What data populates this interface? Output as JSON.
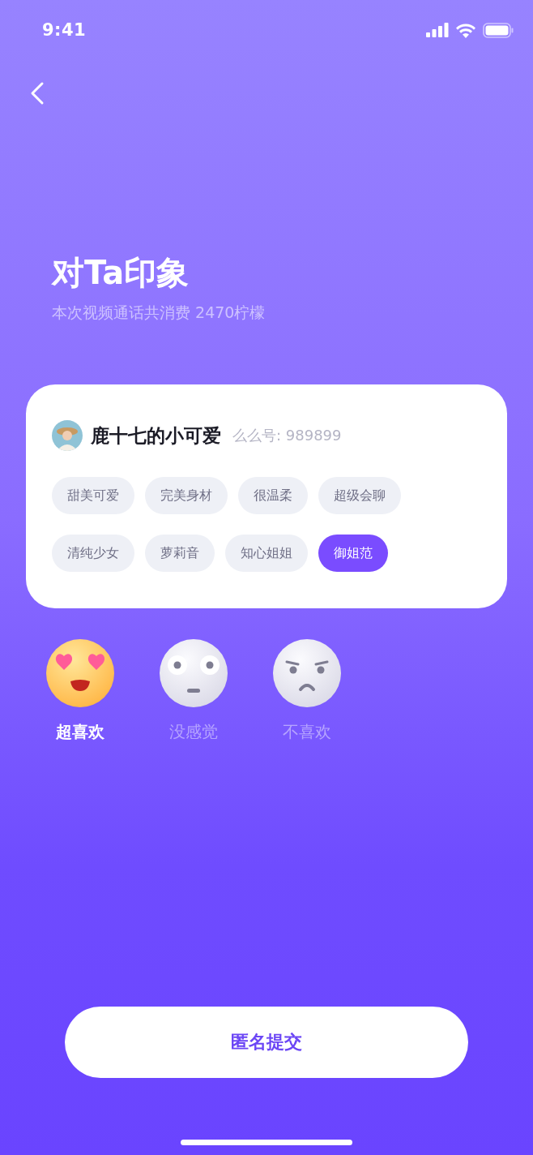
{
  "status_bar": {
    "time": "9:41"
  },
  "header": {
    "title": "对Ta印象",
    "subtitle": "本次视频通话共消费 2470柠檬"
  },
  "profile": {
    "name": "鹿十七的小可爱",
    "id_label": "么么号: 989899"
  },
  "tags": [
    {
      "label": "甜美可爱",
      "selected": false
    },
    {
      "label": "完美身材",
      "selected": false
    },
    {
      "label": "很温柔",
      "selected": false
    },
    {
      "label": "超级会聊",
      "selected": false
    },
    {
      "label": "清纯少女",
      "selected": false
    },
    {
      "label": "萝莉音",
      "selected": false
    },
    {
      "label": "知心姐姐",
      "selected": false
    },
    {
      "label": "御姐范",
      "selected": true
    }
  ],
  "reactions": [
    {
      "kind": "love",
      "label": "超喜欢",
      "selected": true
    },
    {
      "kind": "neutral",
      "label": "没感觉",
      "selected": false
    },
    {
      "kind": "dislike",
      "label": "不喜欢",
      "selected": false
    }
  ],
  "submit_button": {
    "label": "匿名提交"
  }
}
